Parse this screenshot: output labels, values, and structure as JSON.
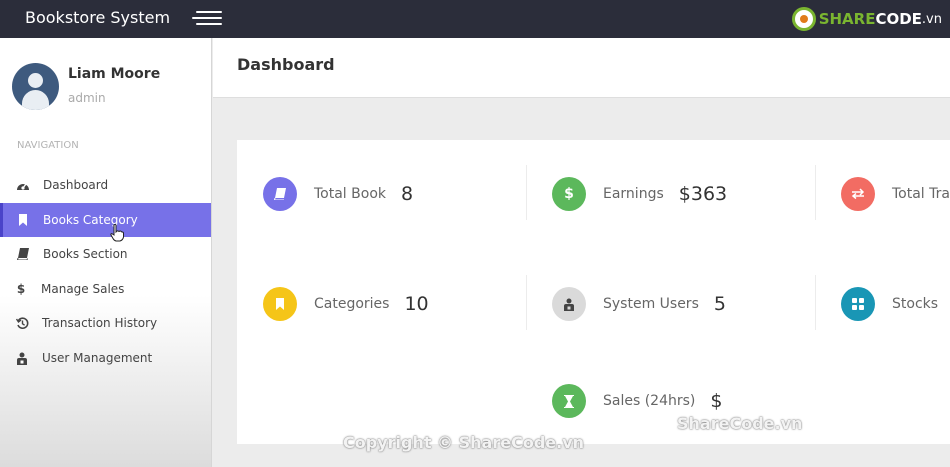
{
  "app": {
    "title": "Bookstore System"
  },
  "user": {
    "name": "Liam Moore",
    "role": "admin"
  },
  "sidebar": {
    "section_title": "NAVIGATION",
    "items": [
      {
        "label": "Dashboard",
        "icon": "dashboard-icon",
        "active": false
      },
      {
        "label": "Books Category",
        "icon": "bookmark-icon",
        "active": true
      },
      {
        "label": "Books Section",
        "icon": "book-icon",
        "active": false
      },
      {
        "label": "Manage Sales",
        "icon": "dollar-icon",
        "active": false
      },
      {
        "label": "Transaction History",
        "icon": "history-icon",
        "active": false
      },
      {
        "label": "User Management",
        "icon": "user-lock-icon",
        "active": false
      }
    ]
  },
  "page": {
    "title": "Dashboard"
  },
  "stats": [
    {
      "label": "Total Book",
      "value": "8",
      "icon": "book-icon",
      "color": "#7771e8"
    },
    {
      "label": "Earnings",
      "value": "$363",
      "icon": "dollar-icon",
      "color": "#5cb85c"
    },
    {
      "label": "Total Tra",
      "value": "",
      "icon": "exchange-icon",
      "color": "#f26c63"
    },
    {
      "label": "Categories",
      "value": "10",
      "icon": "bookmark-icon",
      "color": "#f5c518"
    },
    {
      "label": "System Users",
      "value": "5",
      "icon": "user-lock-icon",
      "color": "#dadada"
    },
    {
      "label": "Stocks",
      "value": "",
      "icon": "grid-icon",
      "color": "#1996b5"
    },
    {
      "label": "Sales (24hrs)",
      "value": "$",
      "icon": "hourglass-icon",
      "color": "#5cb85c"
    }
  ],
  "watermark": {
    "logo_part1": "SHARE",
    "logo_part2": "CODE",
    "logo_part3": ".vn",
    "text1": "ShareCode.vn",
    "text2": "Copyright © ShareCode.vn"
  },
  "colors": {
    "topbar": "#2b2d3a",
    "accent": "#7771e8"
  }
}
